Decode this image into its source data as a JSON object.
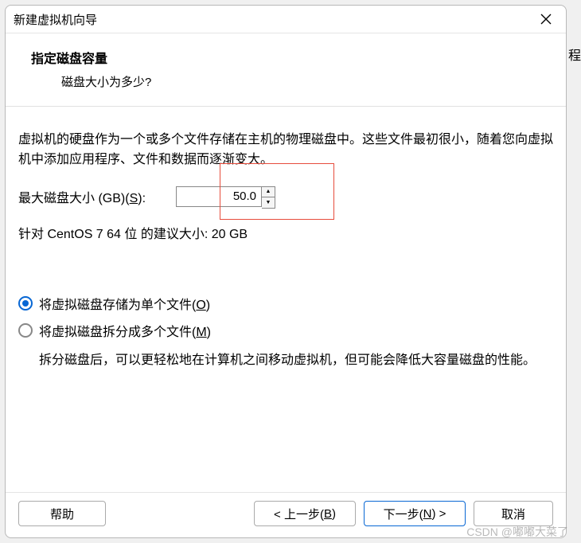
{
  "titlebar": {
    "title": "新建虚拟机向导"
  },
  "header": {
    "title": "指定磁盘容量",
    "subtitle": "磁盘大小为多少?"
  },
  "content": {
    "description": "虚拟机的硬盘作为一个或多个文件存储在主机的物理磁盘中。这些文件最初很小，随着您向虚拟机中添加应用程序、文件和数据而逐渐变大。",
    "disk_size_label_prefix": "最大磁盘大小 (GB)(",
    "disk_size_hotkey": "S",
    "disk_size_label_suffix": "):",
    "disk_size_value": "50.0",
    "recommendation": "针对 CentOS 7 64 位 的建议大小: 20 GB",
    "radio_single_prefix": "将虚拟磁盘存储为单个文件(",
    "radio_single_hotkey": "O",
    "radio_single_suffix": ")",
    "radio_split_prefix": "将虚拟磁盘拆分成多个文件(",
    "radio_split_hotkey": "M",
    "radio_split_suffix": ")",
    "split_desc": "拆分磁盘后，可以更轻松地在计算机之间移动虚拟机，但可能会降低大容量磁盘的性能。"
  },
  "footer": {
    "help": "帮助",
    "back_prefix": "< 上一步(",
    "back_hotkey": "B",
    "back_suffix": ")",
    "next_prefix": "下一步(",
    "next_hotkey": "N",
    "next_suffix": ") >",
    "cancel": "取消"
  },
  "watermark": "CSDN @嘟嘟大菜了",
  "side_fragment": "程"
}
